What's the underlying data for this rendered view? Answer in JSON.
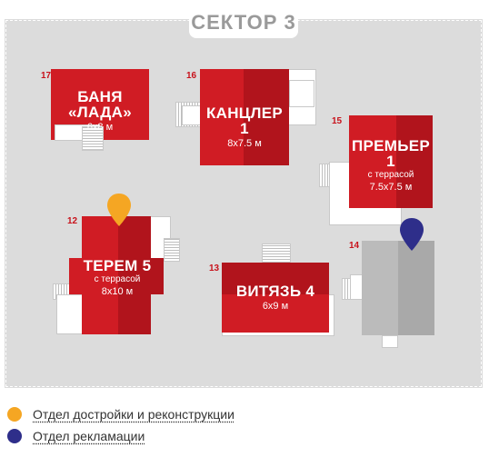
{
  "sector_title": "СЕКТОР 3",
  "houses": [
    {
      "number": "17",
      "name": "БАНЯ «ЛАДА»",
      "subtitle": "",
      "size": "6x8 м",
      "status": "available"
    },
    {
      "number": "16",
      "name": "КАНЦЛЕР 1",
      "subtitle": "",
      "size": "8x7.5 м",
      "status": "available"
    },
    {
      "number": "15",
      "name": "ПРЕМЬЕР 1",
      "subtitle": "с террасой",
      "size": "7.5x7.5 м",
      "status": "available"
    },
    {
      "number": "12",
      "name": "ТЕРЕМ 5",
      "subtitle": "с террасой",
      "size": "8x10 м",
      "status": "available",
      "marker": "reconstruction"
    },
    {
      "number": "13",
      "name": "ВИТЯЗЬ 4",
      "subtitle": "",
      "size": "6x9 м",
      "status": "available"
    },
    {
      "number": "14",
      "name": "",
      "subtitle": "",
      "size": "",
      "status": "office",
      "marker": "complaints"
    }
  ],
  "legend": [
    {
      "color": "#f5a623",
      "label": "Отдел достройки и реконструкции",
      "icon": "orange-dot-icon"
    },
    {
      "color": "#2e2e8a",
      "label": "Отдел рекламации",
      "icon": "blue-dot-icon"
    }
  ],
  "colors": {
    "house_red": "#d01c24",
    "house_red_dark": "#b1141c",
    "office_gray": "#a9a9a9",
    "map_background": "#dcdcdc",
    "pin_orange": "#f5a623",
    "pin_blue": "#2e2e8a"
  }
}
